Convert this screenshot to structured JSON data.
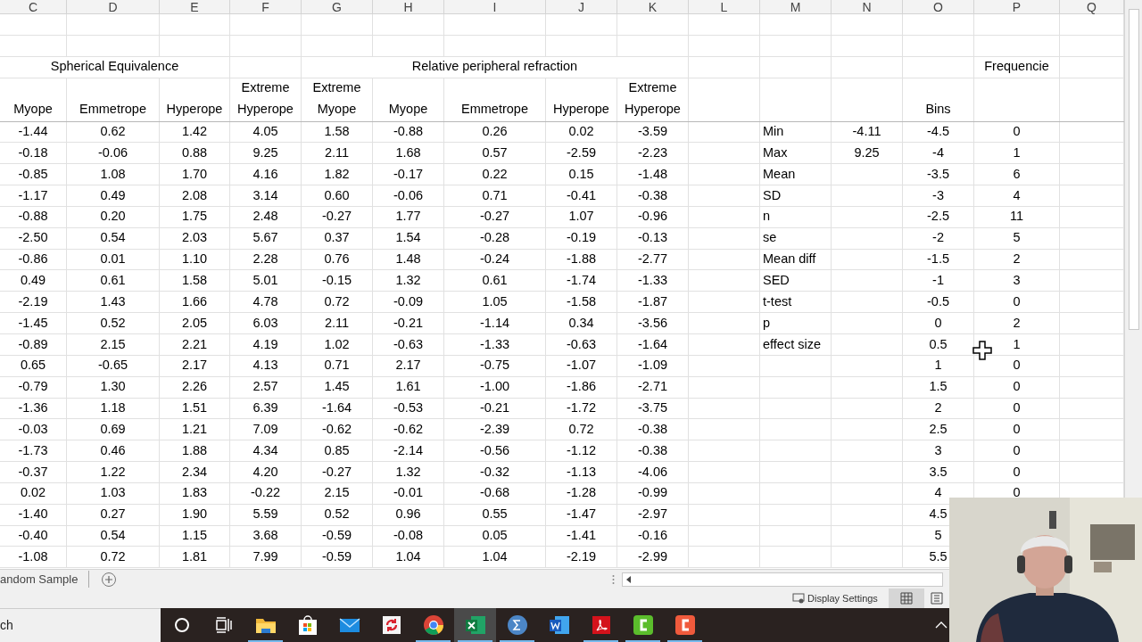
{
  "column_letters": [
    "C",
    "D",
    "E",
    "F",
    "G",
    "H",
    "I",
    "J",
    "K",
    "L",
    "M",
    "N",
    "O",
    "P",
    "Q"
  ],
  "group_titles": [
    {
      "text": "Spherical Equivalence",
      "kind": "spherical"
    },
    {
      "text": "Relative peripheral refraction",
      "kind": "relative"
    },
    {
      "text": "Frequencie",
      "kind": "frequency"
    }
  ],
  "headers": [
    "Myope",
    "Emmetrope",
    "Hyperope",
    "Extreme Hyperope",
    "Extreme Myope",
    "Myope",
    "Emmetrope",
    "Hyperope",
    "Extreme Hyperope"
  ],
  "bins_header": "Bins",
  "rows": [
    {
      "values": [
        "-1.44",
        "0.62",
        "1.42",
        "4.05",
        "1.58",
        "-0.88",
        "0.26",
        "0.02",
        "-3.59"
      ],
      "stat_label": "Min",
      "stat_value": "-4.11",
      "bin": "-4.5",
      "frequency": "0"
    },
    {
      "values": [
        "-0.18",
        "-0.06",
        "0.88",
        "9.25",
        "2.11",
        "1.68",
        "0.57",
        "-2.59",
        "-2.23"
      ],
      "stat_label": "Max",
      "stat_value": "9.25",
      "bin": "-4",
      "frequency": "1"
    },
    {
      "values": [
        "-0.85",
        "1.08",
        "1.70",
        "4.16",
        "1.82",
        "-0.17",
        "0.22",
        "0.15",
        "-1.48"
      ],
      "stat_label": "Mean",
      "bin": "-3.5",
      "frequency": "6"
    },
    {
      "values": [
        "-1.17",
        "0.49",
        "2.08",
        "3.14",
        "0.60",
        "-0.06",
        "0.71",
        "-0.41",
        "-0.38"
      ],
      "stat_label": "SD",
      "bin": "-3",
      "frequency": "4"
    },
    {
      "values": [
        "-0.88",
        "0.20",
        "1.75",
        "2.48",
        "-0.27",
        "1.77",
        "-0.27",
        "1.07",
        "-0.96"
      ],
      "stat_label": "n",
      "bin": "-2.5",
      "frequency": "11"
    },
    {
      "values": [
        "-2.50",
        "0.54",
        "2.03",
        "5.67",
        "0.37",
        "1.54",
        "-0.28",
        "-0.19",
        "-0.13"
      ],
      "stat_label": "se",
      "bin": "-2",
      "frequency": "5"
    },
    {
      "values": [
        "-0.86",
        "0.01",
        "1.10",
        "2.28",
        "0.76",
        "1.48",
        "-0.24",
        "-1.88",
        "-2.77"
      ],
      "stat_label": "Mean diff",
      "bin": "-1.5",
      "frequency": "2"
    },
    {
      "values": [
        "0.49",
        "0.61",
        "1.58",
        "5.01",
        "-0.15",
        "1.32",
        "0.61",
        "-1.74",
        "-1.33"
      ],
      "stat_label": "SED",
      "bin": "-1",
      "frequency": "3"
    },
    {
      "values": [
        "-2.19",
        "1.43",
        "1.66",
        "4.78",
        "0.72",
        "-0.09",
        "1.05",
        "-1.58",
        "-1.87"
      ],
      "stat_label": "t-test",
      "bin": "-0.5",
      "frequency": "0"
    },
    {
      "values": [
        "-1.45",
        "0.52",
        "2.05",
        "6.03",
        "2.11",
        "-0.21",
        "-1.14",
        "0.34",
        "-3.56"
      ],
      "stat_label": "p",
      "bin": "0",
      "frequency": "2"
    },
    {
      "values": [
        "-0.89",
        "2.15",
        "2.21",
        "4.19",
        "1.02",
        "-0.63",
        "-1.33",
        "-0.63",
        "-1.64"
      ],
      "stat_label": "effect size",
      "bin": "0.5",
      "frequency": "1"
    },
    {
      "values": [
        "0.65",
        "-0.65",
        "2.17",
        "4.13",
        "0.71",
        "2.17",
        "-0.75",
        "-1.07",
        "-1.09"
      ],
      "bin": "1",
      "frequency": "0"
    },
    {
      "values": [
        "-0.79",
        "1.30",
        "2.26",
        "2.57",
        "1.45",
        "1.61",
        "-1.00",
        "-1.86",
        "-2.71"
      ],
      "bin": "1.5",
      "frequency": "0"
    },
    {
      "values": [
        "-1.36",
        "1.18",
        "1.51",
        "6.39",
        "-1.64",
        "-0.53",
        "-0.21",
        "-1.72",
        "-3.75"
      ],
      "bin": "2",
      "frequency": "0"
    },
    {
      "values": [
        "-0.03",
        "0.69",
        "1.21",
        "7.09",
        "-0.62",
        "-0.62",
        "-2.39",
        "0.72",
        "-0.38"
      ],
      "bin": "2.5",
      "frequency": "0"
    },
    {
      "values": [
        "-1.73",
        "0.46",
        "1.88",
        "4.34",
        "0.85",
        "-2.14",
        "-0.56",
        "-1.12",
        "-0.38"
      ],
      "bin": "3",
      "frequency": "0"
    },
    {
      "values": [
        "-0.37",
        "1.22",
        "2.34",
        "4.20",
        "-0.27",
        "1.32",
        "-0.32",
        "-1.13",
        "-4.06"
      ],
      "bin": "3.5",
      "frequency": "0"
    },
    {
      "values": [
        "0.02",
        "1.03",
        "1.83",
        "-0.22",
        "2.15",
        "-0.01",
        "-0.68",
        "-1.28",
        "-0.99"
      ],
      "bin": "4",
      "frequency": "0"
    },
    {
      "values": [
        "-1.40",
        "0.27",
        "1.90",
        "5.59",
        "0.52",
        "0.96",
        "0.55",
        "-1.47",
        "-2.97"
      ],
      "bin": "4.5"
    },
    {
      "values": [
        "-0.40",
        "0.54",
        "1.15",
        "3.68",
        "-0.59",
        "-0.08",
        "0.05",
        "-1.41",
        "-0.16"
      ],
      "bin": "5"
    },
    {
      "values": [
        "-1.08",
        "0.72",
        "1.81",
        "7.99",
        "-0.59",
        "1.04",
        "1.04",
        "-2.19",
        "-2.99"
      ],
      "bin": "5.5"
    }
  ],
  "sheet_tab": {
    "label": "andom Sample"
  },
  "status_bar": {
    "display_settings": "Display Settings",
    "views": [
      {
        "kind": "normal",
        "selected": true
      },
      {
        "kind": "page_layout",
        "selected": false
      }
    ]
  },
  "taskbar": {
    "search": "ch",
    "apps": [
      {
        "kind": "cortana",
        "open": false,
        "selected": false
      },
      {
        "kind": "task_view",
        "open": false,
        "selected": false
      },
      {
        "kind": "folder",
        "open": true,
        "selected": false
      },
      {
        "kind": "store",
        "open": false,
        "selected": false
      },
      {
        "kind": "mail",
        "open": false,
        "selected": false
      },
      {
        "kind": "sync",
        "open": false,
        "selected": false
      },
      {
        "kind": "chrome",
        "open": true,
        "selected": false
      },
      {
        "kind": "excel",
        "open": true,
        "selected": true
      },
      {
        "kind": "sigma",
        "open": true,
        "selected": false
      },
      {
        "kind": "word",
        "open": false,
        "selected": false
      },
      {
        "kind": "pdf",
        "open": true,
        "selected": false
      },
      {
        "kind": "c_green",
        "open": true,
        "selected": false
      },
      {
        "kind": "c_orange",
        "open": true,
        "selected": false
      }
    ]
  }
}
